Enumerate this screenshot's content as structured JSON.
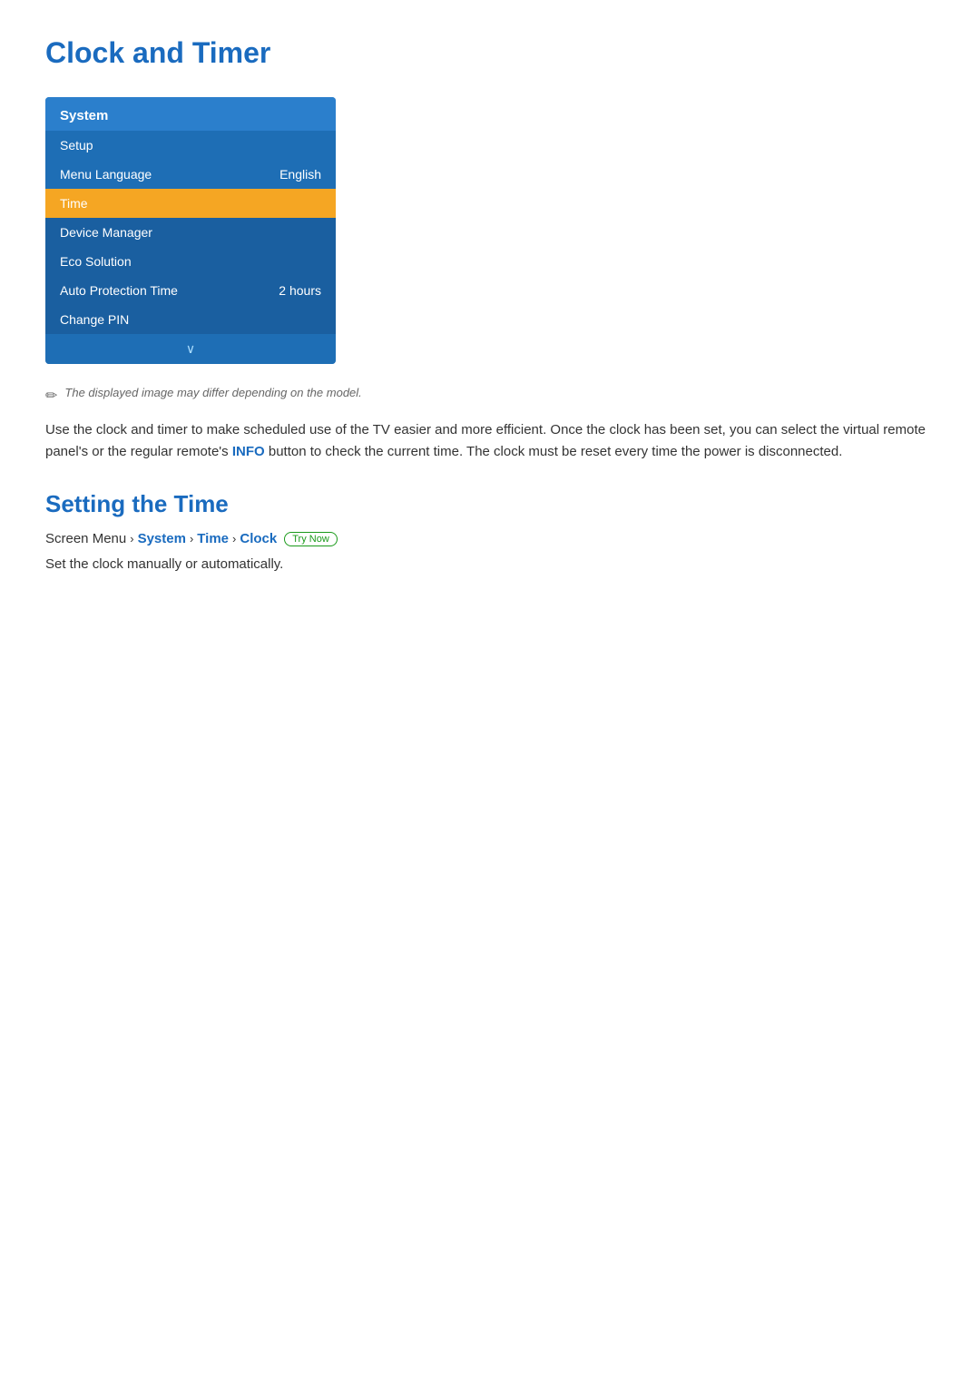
{
  "page": {
    "title": "Clock and Timer"
  },
  "menu": {
    "header": "System",
    "items": [
      {
        "label": "Setup",
        "value": "",
        "state": "normal"
      },
      {
        "label": "Menu Language",
        "value": "English",
        "state": "normal"
      },
      {
        "label": "Time",
        "value": "",
        "state": "highlighted"
      },
      {
        "label": "Device Manager",
        "value": "",
        "state": "dark"
      },
      {
        "label": "Eco Solution",
        "value": "",
        "state": "dark"
      },
      {
        "label": "Auto Protection Time",
        "value": "2 hours",
        "state": "dark"
      },
      {
        "label": "Change PIN",
        "value": "",
        "state": "dark"
      }
    ],
    "chevron": "∨"
  },
  "note": {
    "icon": "✏",
    "text": "The displayed image may differ depending on the model."
  },
  "body_text": {
    "part1": "Use the clock and timer to make scheduled use of the TV easier and more efficient. Once the clock has been set, you can select the virtual remote panel's or the regular remote's ",
    "info_word": "INFO",
    "part2": " button to check the current time. The clock must be reset every time the power is disconnected."
  },
  "setting_section": {
    "title": "Setting the Time",
    "breadcrumb": {
      "prefix": "Screen Menu",
      "sep1": "›",
      "system": "System",
      "sep2": "›",
      "time": "Time",
      "sep3": "›",
      "clock": "Clock",
      "badge": "Try Now"
    },
    "description": "Set the clock manually or automatically."
  }
}
